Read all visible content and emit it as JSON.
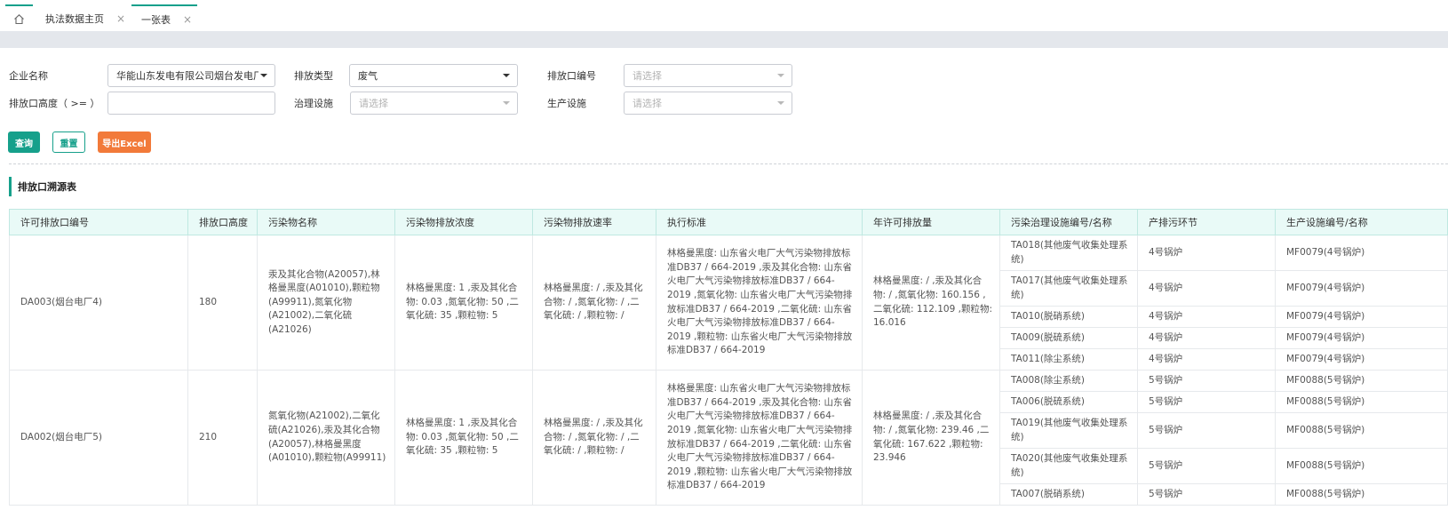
{
  "tabs": {
    "home_icon": "home-icon",
    "items": [
      {
        "label": "执法数据主页",
        "close": "×"
      },
      {
        "label": "一张表",
        "close": "×"
      }
    ]
  },
  "filters": {
    "company_label": "企业名称",
    "company_value": "华能山东发电有限公司烟台发电厂",
    "emission_type_label": "排放类型",
    "emission_type_value": "废气",
    "outlet_no_label": "排放口编号",
    "outlet_no_placeholder": "请选择",
    "height_label": "排放口高度（ >= ）",
    "height_value": "",
    "treatment_label": "治理设施",
    "treatment_placeholder": "请选择",
    "production_label": "生产设施",
    "production_placeholder": "请选择"
  },
  "buttons": {
    "query": "查询",
    "reset": "重置",
    "export": "导出Excel"
  },
  "section_title": "排放口溯源表",
  "table": {
    "headers": [
      "许可排放口编号",
      "排放口高度",
      "污染物名称",
      "污染物排放浓度",
      "污染物排放速率",
      "执行标准",
      "年许可排放量",
      "污染治理设施编号/名称",
      "产排污环节",
      "生产设施编号/名称"
    ],
    "rows": [
      {
        "outlet": "DA003(烟台电厂4)",
        "height": "180",
        "pollutants": "汞及其化合物(A20057),林格曼黑度(A01010),颗粒物(A99911),氮氧化物(A21002),二氧化硫(A21026)",
        "concentration": "林格曼黑度: 1 ,汞及其化合物: 0.03 ,氮氧化物: 50 ,二氧化硫: 35 ,颗粒物: 5",
        "rate": "林格曼黑度: / ,汞及其化合物: / ,氮氧化物: / ,二氧化硫: / ,颗粒物: /",
        "standard": "林格曼黑度: 山东省火电厂大气污染物排放标准DB37 /  664-2019 ,汞及其化合物: 山东省火电厂大气污染物排放标准DB37 /  664-2019 ,氮氧化物: 山东省火电厂大气污染物排放标准DB37 /  664-2019 ,二氧化硫: 山东省火电厂大气污染物排放标准DB37 /  664-2019 ,颗粒物: 山东省火电厂大气污染物排放标准DB37 /  664-2019",
        "annual": "林格曼黑度: / ,汞及其化合物: / ,氮氧化物: 160.156 ,二氧化硫: 112.109 ,颗粒物: 16.016",
        "subs": [
          {
            "facility": "TA018(其他废气收集处理系统)",
            "link": "4号锅炉",
            "prod": "MF0079(4号锅炉)"
          },
          {
            "facility": "TA017(其他废气收集处理系统)",
            "link": "4号锅炉",
            "prod": "MF0079(4号锅炉)"
          },
          {
            "facility": "TA010(脱硝系统)",
            "link": "4号锅炉",
            "prod": "MF0079(4号锅炉)"
          },
          {
            "facility": "TA009(脱硫系统)",
            "link": "4号锅炉",
            "prod": "MF0079(4号锅炉)"
          },
          {
            "facility": "TA011(除尘系统)",
            "link": "4号锅炉",
            "prod": "MF0079(4号锅炉)"
          }
        ]
      },
      {
        "outlet": "DA002(烟台电厂5)",
        "height": "210",
        "pollutants": "氮氧化物(A21002),二氧化硫(A21026),汞及其化合物(A20057),林格曼黑度(A01010),颗粒物(A99911)",
        "concentration": "林格曼黑度: 1 ,汞及其化合物: 0.03 ,氮氧化物: 50 ,二氧化硫: 35 ,颗粒物: 5",
        "rate": "林格曼黑度: / ,汞及其化合物: / ,氮氧化物: / ,二氧化硫: / ,颗粒物: /",
        "standard": "林格曼黑度: 山东省火电厂大气污染物排放标准DB37 /  664-2019 ,汞及其化合物: 山东省火电厂大气污染物排放标准DB37 /  664-2019 ,氮氧化物: 山东省火电厂大气污染物排放标准DB37 /  664-2019 ,二氧化硫: 山东省火电厂大气污染物排放标准DB37 /  664-2019 ,颗粒物: 山东省火电厂大气污染物排放标准DB37 /  664-2019",
        "annual": "林格曼黑度: / ,汞及其化合物: / ,氮氧化物: 239.46 ,二氧化硫: 167.622 ,颗粒物: 23.946",
        "subs": [
          {
            "facility": "TA008(除尘系统)",
            "link": "5号锅炉",
            "prod": "MF0088(5号锅炉)"
          },
          {
            "facility": "TA006(脱硫系统)",
            "link": "5号锅炉",
            "prod": "MF0088(5号锅炉)"
          },
          {
            "facility": "TA019(其他废气收集处理系统)",
            "link": "5号锅炉",
            "prod": "MF0088(5号锅炉)"
          },
          {
            "facility": "TA020(其他废气收集处理系统)",
            "link": "5号锅炉",
            "prod": "MF0088(5号锅炉)"
          },
          {
            "facility": "TA007(脱硝系统)",
            "link": "5号锅炉",
            "prod": "MF0088(5号锅炉)"
          }
        ]
      }
    ]
  }
}
